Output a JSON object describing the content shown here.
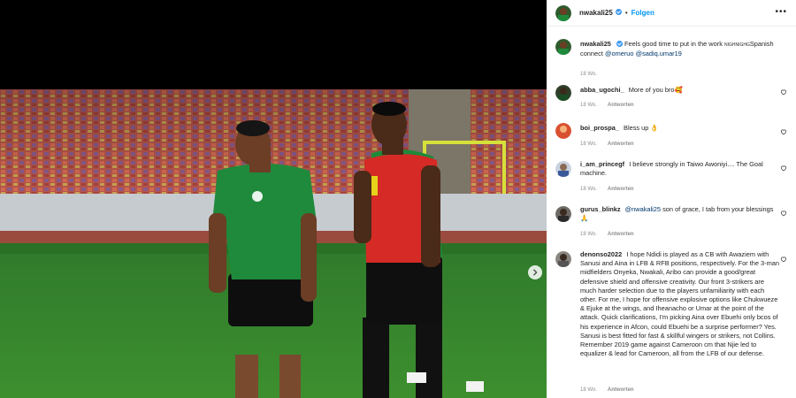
{
  "header": {
    "username": "nwakali25",
    "dot": "•",
    "follow_label": "Folgen",
    "more_icon": "more-icon"
  },
  "caption": {
    "username": "nwakali25",
    "text_before": "Feels good time to put in the work",
    "small_caps": "NIGHNIGHG",
    "text_after": "Spanish connect",
    "mention1": "@omeruo",
    "mention2": "@sadiq.umar19",
    "time": "18 Wo."
  },
  "comments": [
    {
      "username": "abba_ugochi_",
      "text": "More of you bro🥰",
      "time": "18 Wo.",
      "reply": "Antworten"
    },
    {
      "username": "boi_prospa_",
      "text": "Bless up 👌",
      "time": "18 Wo.",
      "reply": "Antworten"
    },
    {
      "username": "i_am_princegf",
      "text": "I believe strongly in Taiwo Awoniyi.... The Goal machine.",
      "time": "18 Wo.",
      "reply": "Antworten"
    },
    {
      "username": "gurus_blinkz",
      "mention": "@nwakali25",
      "text": "son of grace, I tab from your blessings 🙏",
      "time": "18 Wo.",
      "reply": "Antworten"
    },
    {
      "username": "denonso2022",
      "text": "I hope Ndidi is played as a CB with Awaziem with Sanusi and Aina in LFB & RFB positions, respectively. For the 3-man midfielders Onyeka, Nwakali, Aribo can provide a good/great defensive shield and offensive creativity. Our front 3-strikers are much harder selection due to the players unfamiliarity with each other. For me, I hope for offensive explosive options like Chukwueze & Ejuke at the wings, and Iheanacho or Umar at the point of the attack. Quick clarifications, I'm picking Aina over Ebuehi only bcos of his experience in Afcon, could Ebuehi be a surprise performer? Yes. Sanusi is best fitted for fast & skillful wingers or strikers, not Collins. Remember 2019 game against Cameroon cm that Njie led to equalizer & lead for Cameroon, all from the LFB of our defense.",
      "time": "18 Wo.",
      "reply": "Antworten"
    }
  ],
  "colors": {
    "accent": "#0095f6",
    "text": "#262626",
    "muted": "#8e8e8e",
    "verified": "#3897f0"
  }
}
